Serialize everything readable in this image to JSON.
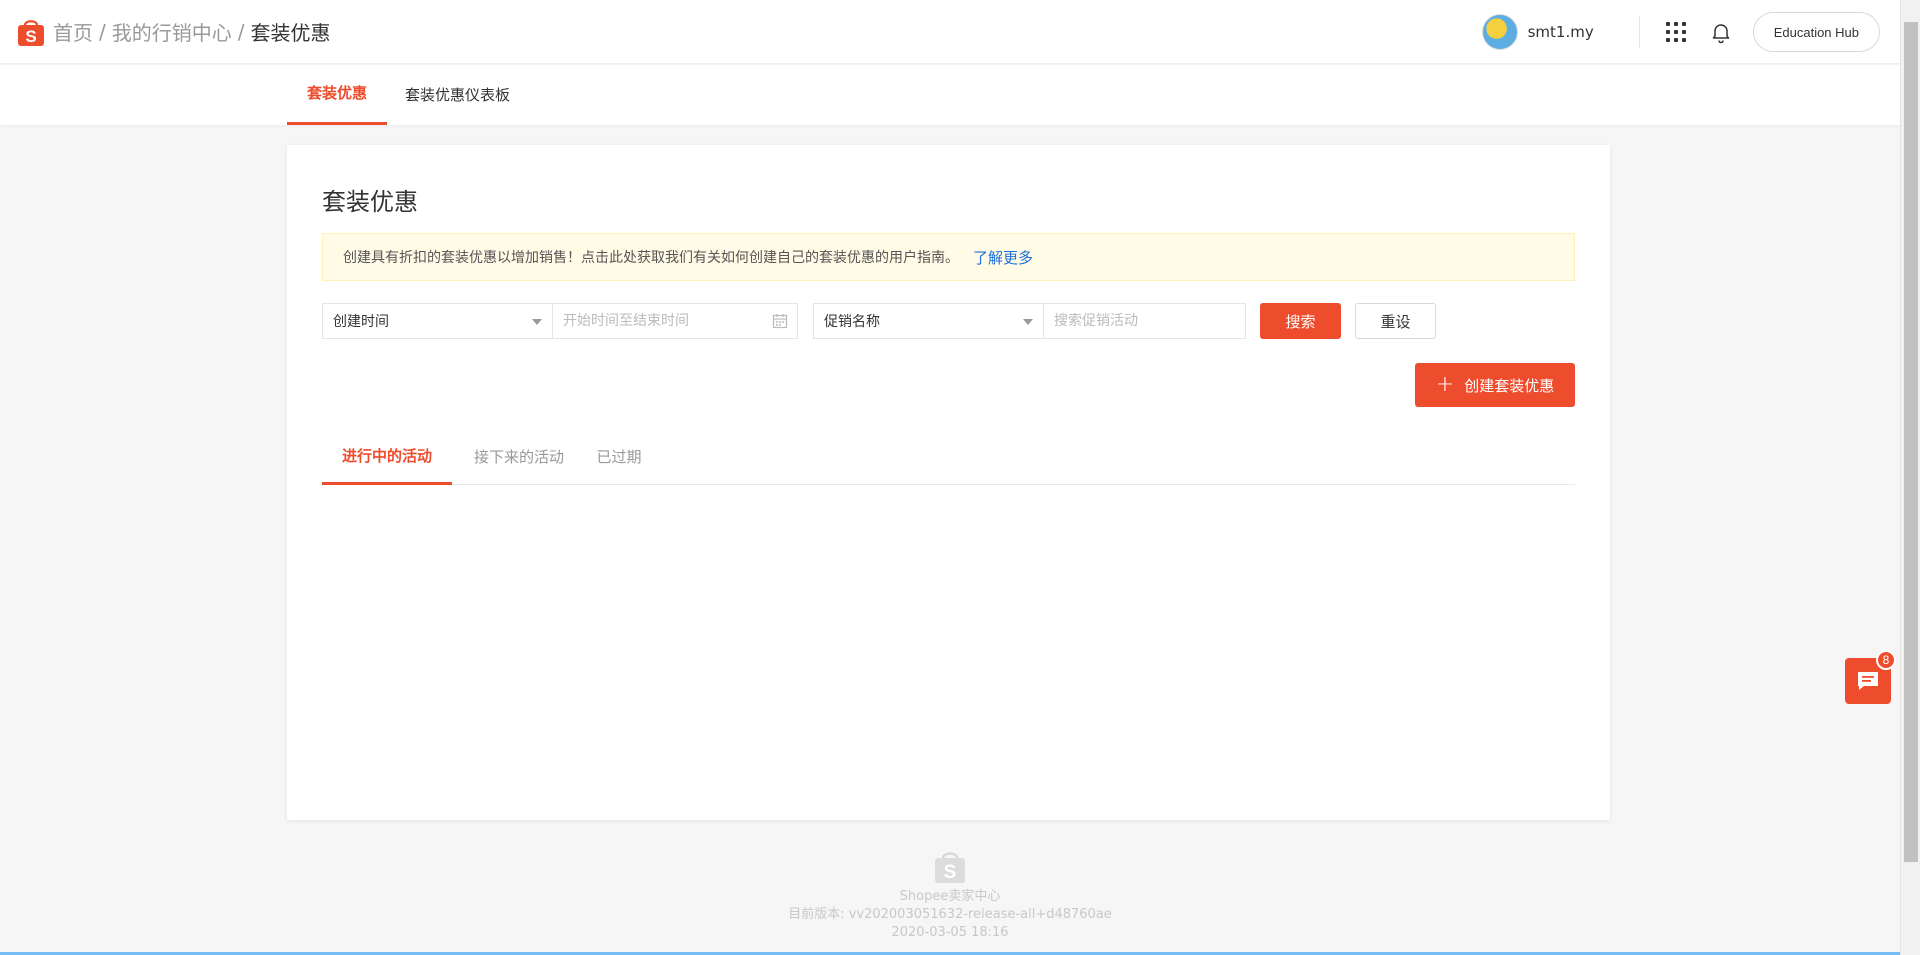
{
  "header": {
    "breadcrumb": [
      "首页",
      "我的行销中心",
      "套装优惠"
    ],
    "separator": "/",
    "username": "smt1.my",
    "edu_hub_label": "Education Hub",
    "icons": {
      "logo": "shopee-bag-logo",
      "apps": "grid-icon",
      "notifications": "bell-icon"
    }
  },
  "subnav": {
    "tabs": [
      {
        "label": "套装优惠",
        "active": true
      },
      {
        "label": "套装优惠仪表板",
        "active": false
      }
    ]
  },
  "card": {
    "title": "套装优惠",
    "notice_text": "创建具有折扣的套装优惠以增加销售！点击此处获取我们有关如何创建自己的套装优惠的用户指南。",
    "notice_link": "了解更多",
    "filters": {
      "time_select": "创建时间",
      "date_placeholder": "开始时间至结束时间",
      "name_select": "促销名称",
      "search_placeholder": "搜索促销活动",
      "search_button": "搜索",
      "reset_button": "重设"
    },
    "create_button": "创建套装优惠",
    "tabs": [
      {
        "label": "进行中的活动",
        "active": true
      },
      {
        "label": "接下来的活动",
        "active": false
      },
      {
        "label": "已过期",
        "active": false
      }
    ]
  },
  "footer": {
    "line1": "Shopee卖家中心",
    "line2": "目前版本: vv202003051632-release-all+d48760ae",
    "line3": "2020-03-05 18:16"
  },
  "chat": {
    "badge": "8"
  },
  "colors": {
    "accent": "#ee4d2d",
    "link": "#1e6fd9",
    "notice_bg": "#fffbe6"
  }
}
